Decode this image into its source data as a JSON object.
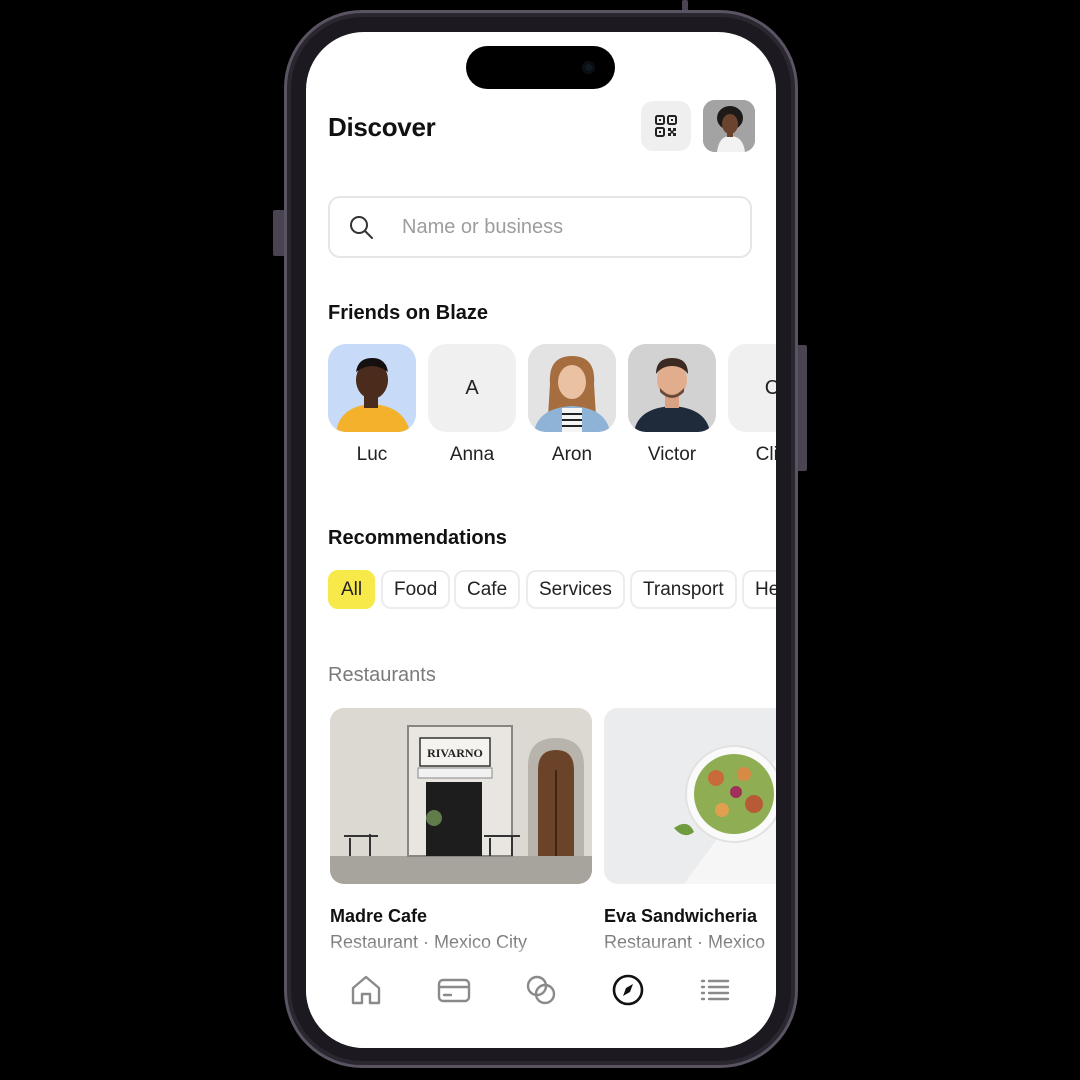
{
  "header": {
    "title": "Discover",
    "qr_icon": "qr-code-icon",
    "profile_avatar": "profile-avatar"
  },
  "search": {
    "placeholder": "Name or business",
    "value": ""
  },
  "friends": {
    "title": "Friends on Blaze",
    "items": [
      {
        "name": "Luc",
        "initial": ""
      },
      {
        "name": "Anna",
        "initial": "A"
      },
      {
        "name": "Aron",
        "initial": ""
      },
      {
        "name": "Victor",
        "initial": ""
      },
      {
        "name": "Clin",
        "initial": "C"
      }
    ]
  },
  "recommendations": {
    "title": "Recommendations",
    "chips": [
      "All",
      "Food",
      "Cafe",
      "Services",
      "Transport",
      "He"
    ],
    "active_chip": "All"
  },
  "restaurants": {
    "title": "Restaurants",
    "items": [
      {
        "name": "Madre Cafe",
        "meta": "Restaurant · Mexico City",
        "sign": "RIVARNO"
      },
      {
        "name": "Eva Sandwicheria",
        "meta": "Restaurant · Mexico"
      }
    ]
  },
  "tabbar": {
    "items": [
      {
        "icon": "home-icon"
      },
      {
        "icon": "card-icon"
      },
      {
        "icon": "exchange-icon"
      },
      {
        "icon": "compass-icon",
        "active": true
      },
      {
        "icon": "list-icon"
      }
    ]
  },
  "colors": {
    "accent": "#f8e94a",
    "text": "#111111",
    "muted": "#7a7a7a",
    "frame": "#5a5362"
  }
}
